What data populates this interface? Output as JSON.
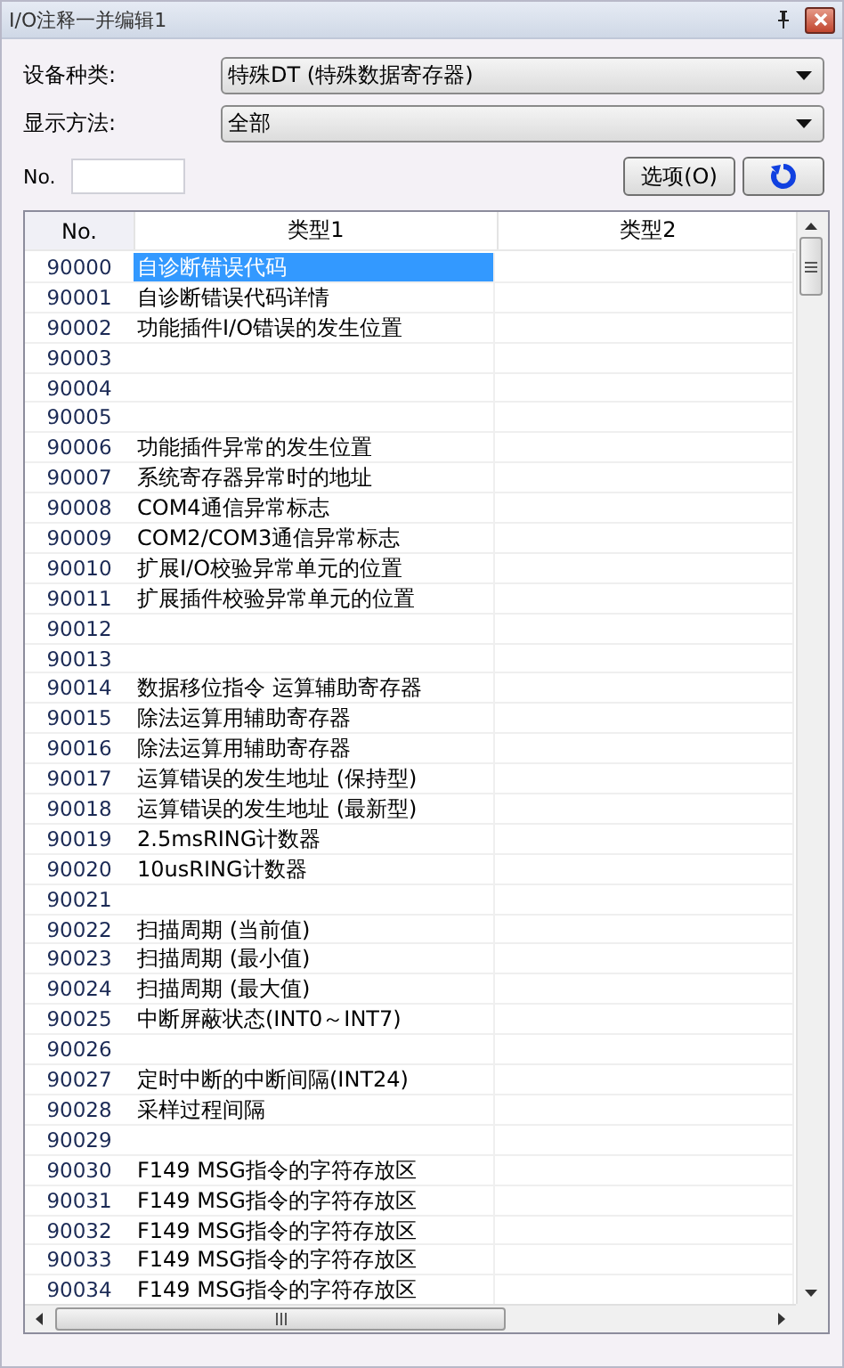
{
  "window": {
    "title": "I/O注释一并编辑1"
  },
  "fields": [
    {
      "label": "设备种类:",
      "value": "特殊DT (特殊数据寄存器)"
    },
    {
      "label": "显示方法:",
      "value": "全部"
    }
  ],
  "no_field": {
    "label": "No."
  },
  "buttons": {
    "options": "选项(O)"
  },
  "table": {
    "columns": [
      "No.",
      "类型1",
      "类型2"
    ],
    "rows": [
      {
        "no": "90000",
        "type1": "自诊断错误代码",
        "selected": true
      },
      {
        "no": "90001",
        "type1": "自诊断错误代码详情",
        "selected": false
      },
      {
        "no": "90002",
        "type1": "功能插件I/O错误的发生位置",
        "selected": false
      },
      {
        "no": "90003",
        "type1": "",
        "selected": false
      },
      {
        "no": "90004",
        "type1": "",
        "selected": false
      },
      {
        "no": "90005",
        "type1": "",
        "selected": false
      },
      {
        "no": "90006",
        "type1": "功能插件异常的发生位置",
        "selected": false
      },
      {
        "no": "90007",
        "type1": "系统寄存器异常时的地址",
        "selected": false
      },
      {
        "no": "90008",
        "type1": "COM4通信异常标志",
        "selected": false
      },
      {
        "no": "90009",
        "type1": "COM2/COM3通信异常标志",
        "selected": false
      },
      {
        "no": "90010",
        "type1": "扩展I/O校验异常单元的位置",
        "selected": false
      },
      {
        "no": "90011",
        "type1": "扩展插件校验异常单元的位置",
        "selected": false
      },
      {
        "no": "90012",
        "type1": "",
        "selected": false
      },
      {
        "no": "90013",
        "type1": "",
        "selected": false
      },
      {
        "no": "90014",
        "type1": "数据移位指令 运算辅助寄存器",
        "selected": false
      },
      {
        "no": "90015",
        "type1": "除法运算用辅助寄存器",
        "selected": false
      },
      {
        "no": "90016",
        "type1": "除法运算用辅助寄存器",
        "selected": false
      },
      {
        "no": "90017",
        "type1": "运算错误的发生地址 (保持型)",
        "selected": false
      },
      {
        "no": "90018",
        "type1": "运算错误的发生地址 (最新型)",
        "selected": false
      },
      {
        "no": "90019",
        "type1": "2.5msRING计数器",
        "selected": false
      },
      {
        "no": "90020",
        "type1": "10usRING计数器",
        "selected": false
      },
      {
        "no": "90021",
        "type1": "",
        "selected": false
      },
      {
        "no": "90022",
        "type1": "扫描周期 (当前值)",
        "selected": false
      },
      {
        "no": "90023",
        "type1": "扫描周期 (最小值)",
        "selected": false
      },
      {
        "no": "90024",
        "type1": "扫描周期 (最大值)",
        "selected": false
      },
      {
        "no": "90025",
        "type1": "中断屏蔽状态(INT0～INT7)",
        "selected": false
      },
      {
        "no": "90026",
        "type1": "",
        "selected": false
      },
      {
        "no": "90027",
        "type1": "定时中断的中断间隔(INT24)",
        "selected": false
      },
      {
        "no": "90028",
        "type1": "采样过程间隔",
        "selected": false
      },
      {
        "no": "90029",
        "type1": "",
        "selected": false
      },
      {
        "no": "90030",
        "type1": "F149 MSG指令的字符存放区",
        "selected": false
      },
      {
        "no": "90031",
        "type1": "F149 MSG指令的字符存放区",
        "selected": false
      },
      {
        "no": "90032",
        "type1": "F149 MSG指令的字符存放区",
        "selected": false
      },
      {
        "no": "90033",
        "type1": "F149 MSG指令的字符存放区",
        "selected": false
      },
      {
        "no": "90034",
        "type1": "F149 MSG指令的字符存放区",
        "selected": false
      }
    ]
  }
}
